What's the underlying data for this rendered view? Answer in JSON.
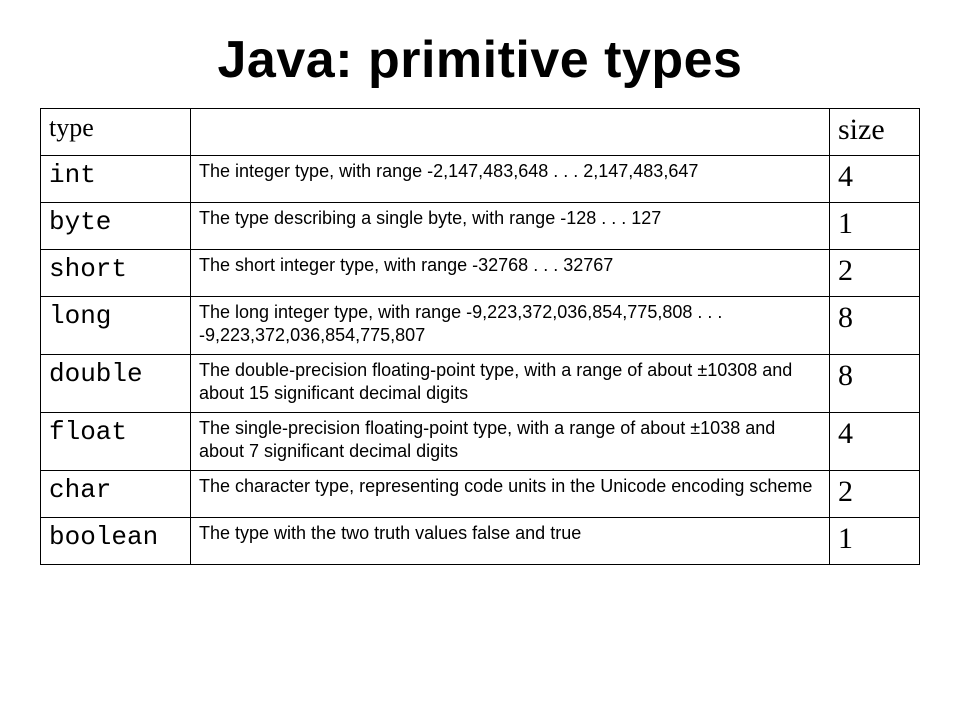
{
  "title": "Java: primitive types",
  "headers": {
    "type": "type",
    "desc": "",
    "size": "size"
  },
  "rows": [
    {
      "name": "int",
      "desc": "The integer type, with range -2,147,483,648 . . . 2,147,483,647",
      "size": "4"
    },
    {
      "name": "byte",
      "desc": "The type describing a single byte, with range -128 . . . 127",
      "size": "1"
    },
    {
      "name": "short",
      "desc": "The short integer type, with range -32768 . . . 32767",
      "size": "2"
    },
    {
      "name": "long",
      "desc": "The long integer type, with range -9,223,372,036,854,775,808 . . . -9,223,372,036,854,775,807",
      "size": "8"
    },
    {
      "name": "double",
      "desc": "The double-precision floating-point type, with a range of about ±10308 and about 15 significant decimal digits",
      "size": "8"
    },
    {
      "name": "float",
      "desc": "The single-precision floating-point type, with a range of about ±1038 and about 7 significant decimal digits",
      "size": "4"
    },
    {
      "name": "char",
      "desc": "The character type, representing code units in the Unicode encoding scheme",
      "size": "2"
    },
    {
      "name": "boolean",
      "desc": "The type with the two truth values false and true",
      "size": "1"
    }
  ]
}
